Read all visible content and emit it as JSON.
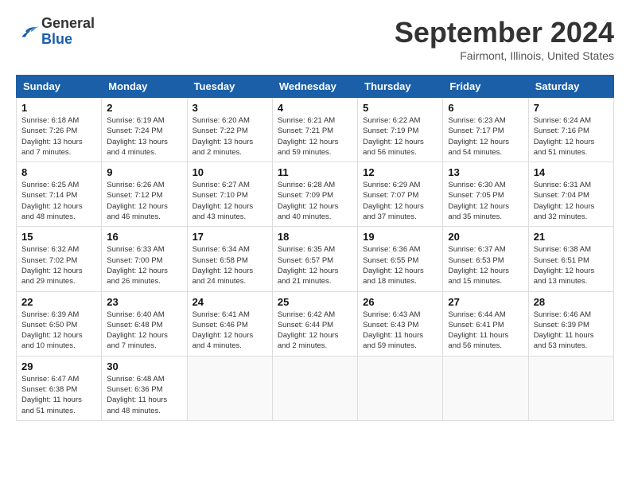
{
  "header": {
    "logo": {
      "general": "General",
      "blue": "Blue"
    },
    "title": "September 2024",
    "location": "Fairmont, Illinois, United States"
  },
  "columns": [
    "Sunday",
    "Monday",
    "Tuesday",
    "Wednesday",
    "Thursday",
    "Friday",
    "Saturday"
  ],
  "weeks": [
    [
      {
        "day": "1",
        "sunrise": "Sunrise: 6:18 AM",
        "sunset": "Sunset: 7:26 PM",
        "daylight": "Daylight: 13 hours and 7 minutes."
      },
      {
        "day": "2",
        "sunrise": "Sunrise: 6:19 AM",
        "sunset": "Sunset: 7:24 PM",
        "daylight": "Daylight: 13 hours and 4 minutes."
      },
      {
        "day": "3",
        "sunrise": "Sunrise: 6:20 AM",
        "sunset": "Sunset: 7:22 PM",
        "daylight": "Daylight: 13 hours and 2 minutes."
      },
      {
        "day": "4",
        "sunrise": "Sunrise: 6:21 AM",
        "sunset": "Sunset: 7:21 PM",
        "daylight": "Daylight: 12 hours and 59 minutes."
      },
      {
        "day": "5",
        "sunrise": "Sunrise: 6:22 AM",
        "sunset": "Sunset: 7:19 PM",
        "daylight": "Daylight: 12 hours and 56 minutes."
      },
      {
        "day": "6",
        "sunrise": "Sunrise: 6:23 AM",
        "sunset": "Sunset: 7:17 PM",
        "daylight": "Daylight: 12 hours and 54 minutes."
      },
      {
        "day": "7",
        "sunrise": "Sunrise: 6:24 AM",
        "sunset": "Sunset: 7:16 PM",
        "daylight": "Daylight: 12 hours and 51 minutes."
      }
    ],
    [
      {
        "day": "8",
        "sunrise": "Sunrise: 6:25 AM",
        "sunset": "Sunset: 7:14 PM",
        "daylight": "Daylight: 12 hours and 48 minutes."
      },
      {
        "day": "9",
        "sunrise": "Sunrise: 6:26 AM",
        "sunset": "Sunset: 7:12 PM",
        "daylight": "Daylight: 12 hours and 46 minutes."
      },
      {
        "day": "10",
        "sunrise": "Sunrise: 6:27 AM",
        "sunset": "Sunset: 7:10 PM",
        "daylight": "Daylight: 12 hours and 43 minutes."
      },
      {
        "day": "11",
        "sunrise": "Sunrise: 6:28 AM",
        "sunset": "Sunset: 7:09 PM",
        "daylight": "Daylight: 12 hours and 40 minutes."
      },
      {
        "day": "12",
        "sunrise": "Sunrise: 6:29 AM",
        "sunset": "Sunset: 7:07 PM",
        "daylight": "Daylight: 12 hours and 37 minutes."
      },
      {
        "day": "13",
        "sunrise": "Sunrise: 6:30 AM",
        "sunset": "Sunset: 7:05 PM",
        "daylight": "Daylight: 12 hours and 35 minutes."
      },
      {
        "day": "14",
        "sunrise": "Sunrise: 6:31 AM",
        "sunset": "Sunset: 7:04 PM",
        "daylight": "Daylight: 12 hours and 32 minutes."
      }
    ],
    [
      {
        "day": "15",
        "sunrise": "Sunrise: 6:32 AM",
        "sunset": "Sunset: 7:02 PM",
        "daylight": "Daylight: 12 hours and 29 minutes."
      },
      {
        "day": "16",
        "sunrise": "Sunrise: 6:33 AM",
        "sunset": "Sunset: 7:00 PM",
        "daylight": "Daylight: 12 hours and 26 minutes."
      },
      {
        "day": "17",
        "sunrise": "Sunrise: 6:34 AM",
        "sunset": "Sunset: 6:58 PM",
        "daylight": "Daylight: 12 hours and 24 minutes."
      },
      {
        "day": "18",
        "sunrise": "Sunrise: 6:35 AM",
        "sunset": "Sunset: 6:57 PM",
        "daylight": "Daylight: 12 hours and 21 minutes."
      },
      {
        "day": "19",
        "sunrise": "Sunrise: 6:36 AM",
        "sunset": "Sunset: 6:55 PM",
        "daylight": "Daylight: 12 hours and 18 minutes."
      },
      {
        "day": "20",
        "sunrise": "Sunrise: 6:37 AM",
        "sunset": "Sunset: 6:53 PM",
        "daylight": "Daylight: 12 hours and 15 minutes."
      },
      {
        "day": "21",
        "sunrise": "Sunrise: 6:38 AM",
        "sunset": "Sunset: 6:51 PM",
        "daylight": "Daylight: 12 hours and 13 minutes."
      }
    ],
    [
      {
        "day": "22",
        "sunrise": "Sunrise: 6:39 AM",
        "sunset": "Sunset: 6:50 PM",
        "daylight": "Daylight: 12 hours and 10 minutes."
      },
      {
        "day": "23",
        "sunrise": "Sunrise: 6:40 AM",
        "sunset": "Sunset: 6:48 PM",
        "daylight": "Daylight: 12 hours and 7 minutes."
      },
      {
        "day": "24",
        "sunrise": "Sunrise: 6:41 AM",
        "sunset": "Sunset: 6:46 PM",
        "daylight": "Daylight: 12 hours and 4 minutes."
      },
      {
        "day": "25",
        "sunrise": "Sunrise: 6:42 AM",
        "sunset": "Sunset: 6:44 PM",
        "daylight": "Daylight: 12 hours and 2 minutes."
      },
      {
        "day": "26",
        "sunrise": "Sunrise: 6:43 AM",
        "sunset": "Sunset: 6:43 PM",
        "daylight": "Daylight: 11 hours and 59 minutes."
      },
      {
        "day": "27",
        "sunrise": "Sunrise: 6:44 AM",
        "sunset": "Sunset: 6:41 PM",
        "daylight": "Daylight: 11 hours and 56 minutes."
      },
      {
        "day": "28",
        "sunrise": "Sunrise: 6:46 AM",
        "sunset": "Sunset: 6:39 PM",
        "daylight": "Daylight: 11 hours and 53 minutes."
      }
    ],
    [
      {
        "day": "29",
        "sunrise": "Sunrise: 6:47 AM",
        "sunset": "Sunset: 6:38 PM",
        "daylight": "Daylight: 11 hours and 51 minutes."
      },
      {
        "day": "30",
        "sunrise": "Sunrise: 6:48 AM",
        "sunset": "Sunset: 6:36 PM",
        "daylight": "Daylight: 11 hours and 48 minutes."
      },
      null,
      null,
      null,
      null,
      null
    ]
  ]
}
